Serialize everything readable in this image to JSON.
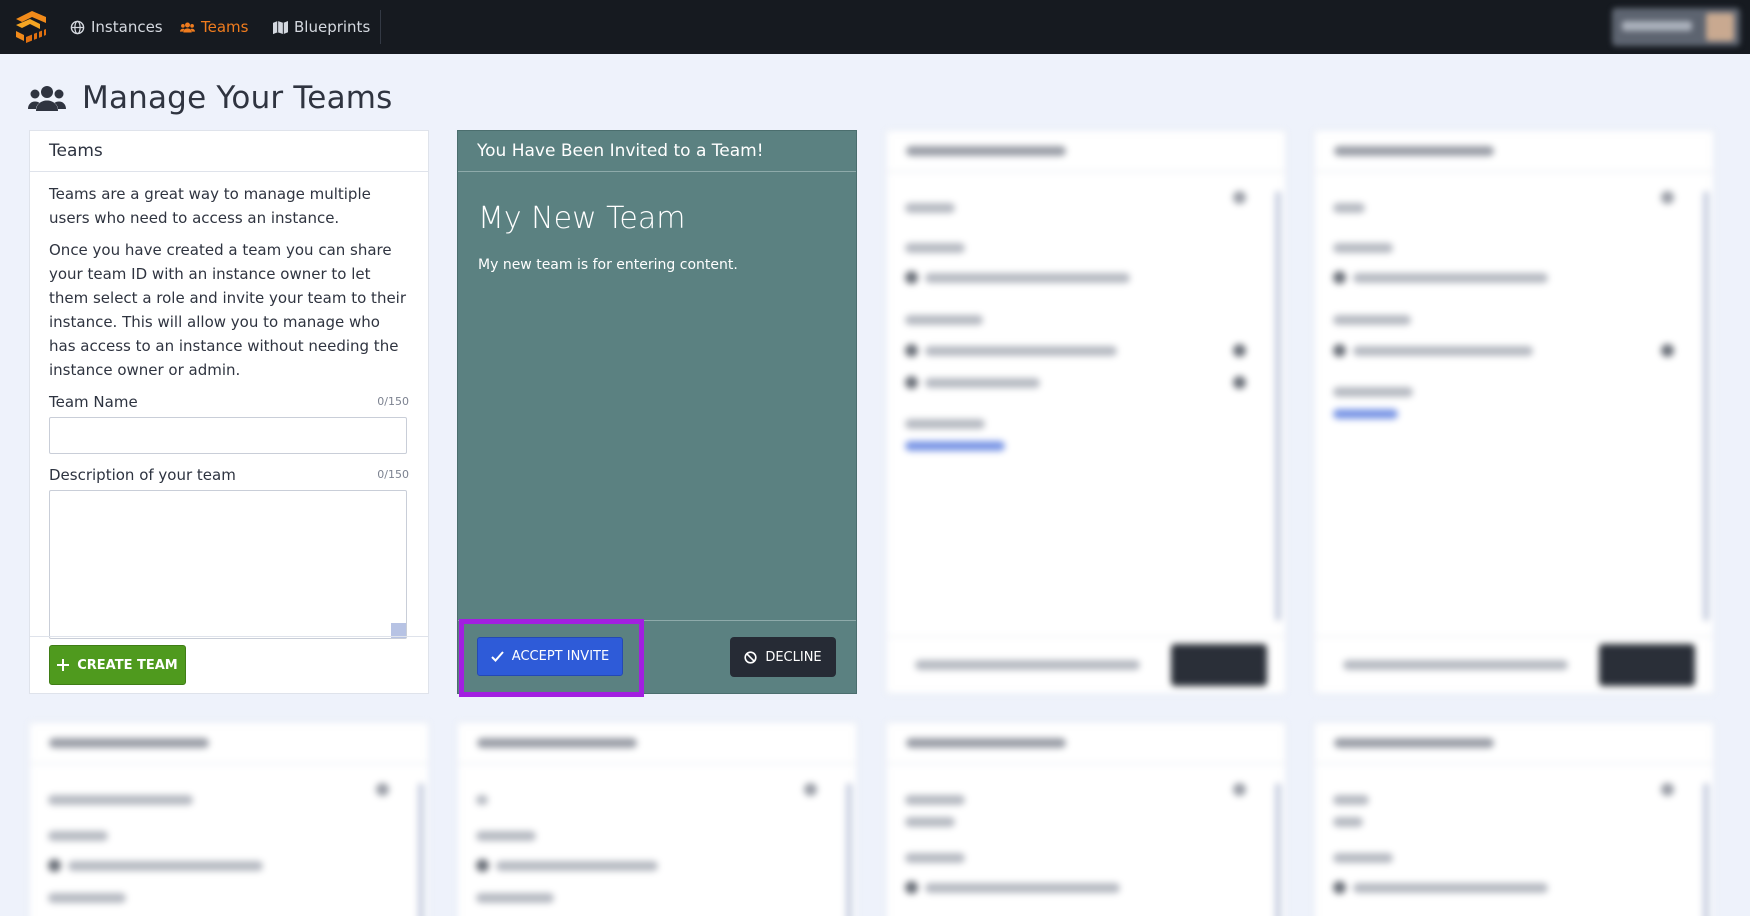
{
  "nav": {
    "items": [
      {
        "label": "Instances",
        "icon": "globe-icon"
      },
      {
        "label": "Teams",
        "icon": "users-icon",
        "active": true
      },
      {
        "label": "Blueprints",
        "icon": "map-icon"
      }
    ],
    "accent_color": "#f07c1e"
  },
  "page": {
    "title": "Manage Your Teams"
  },
  "teams_panel": {
    "header": "Teams",
    "intro_1": "Teams are a great way to manage multiple users who need to access an instance.",
    "intro_2": "Once you have created a team you can share your team ID with an instance owner to let them select a role and invite your team to their instance. This will allow you to manage who has access to an instance without needing the instance owner or admin.",
    "team_name_label": "Team Name",
    "team_name_counter": "0/150",
    "team_name_value": "",
    "description_label": "Description of your team",
    "description_counter": "0/150",
    "description_value": "",
    "create_button": "CREATE TEAM",
    "create_button_color": "#4f9a1e"
  },
  "invite_panel": {
    "header": "You Have Been Invited to a Team!",
    "team_name": "My New Team",
    "team_description": "My new team is for entering content.",
    "accept_button": "ACCEPT INVITE",
    "decline_button": "DECLINE",
    "background_color": "#5b8181",
    "accept_color": "#2e5bd8",
    "highlight_color": "#a21fe0"
  }
}
